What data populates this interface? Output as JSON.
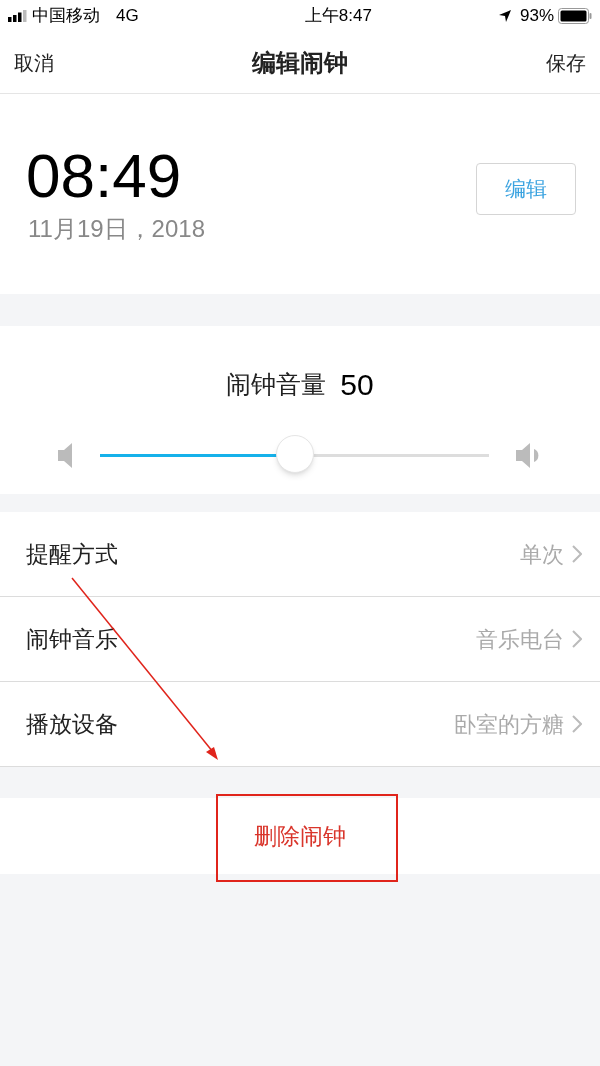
{
  "status_bar": {
    "carrier": "中国移动",
    "network": "4G",
    "time": "上午8:47",
    "battery": "93%"
  },
  "nav": {
    "left": "取消",
    "title": "编辑闹钟",
    "right": "保存"
  },
  "alarm": {
    "time": "08:49",
    "date": "11月19日，2018",
    "edit_button": "编辑"
  },
  "volume": {
    "label": "闹钟音量",
    "value": "50",
    "level": 0.5
  },
  "settings": [
    {
      "label": "提醒方式",
      "value": "单次"
    },
    {
      "label": "闹钟音乐",
      "value": "音乐电台"
    },
    {
      "label": "播放设备",
      "value": "卧室的方糖"
    }
  ],
  "delete_button": "删除闹钟",
  "annotation": {
    "highlight": true
  }
}
